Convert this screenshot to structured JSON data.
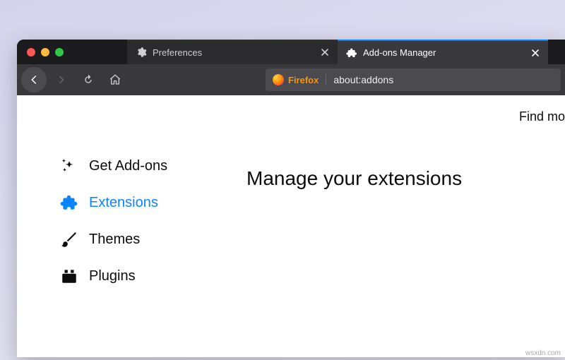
{
  "tabs": {
    "preferences": {
      "label": "Preferences"
    },
    "addons": {
      "label": "Add-ons Manager"
    }
  },
  "urlbar": {
    "brand": "Firefox",
    "address": "about:addons"
  },
  "sidebar": {
    "items": [
      {
        "label": "Get Add-ons"
      },
      {
        "label": "Extensions"
      },
      {
        "label": "Themes"
      },
      {
        "label": "Plugins"
      }
    ]
  },
  "main": {
    "find_more": "Find mo",
    "heading": "Manage your extensions"
  },
  "watermark": "wsxdn.com"
}
